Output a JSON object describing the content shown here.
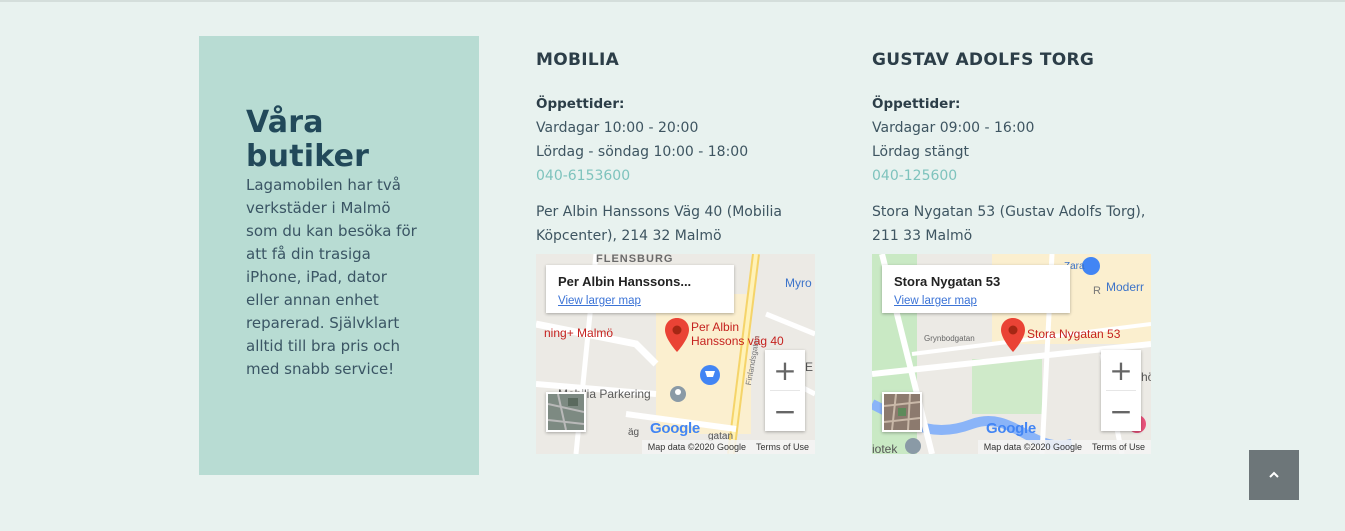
{
  "intro": {
    "title_line1": "Våra",
    "title_line2": "butiker",
    "text_lines": [
      "Lagamobilen har två",
      "verkstäder i Malmö",
      "som du kan besöka för",
      "att få din trasiga",
      "iPhone, iPad, dator",
      "eller annan enhet",
      "reparerad. Självklart",
      "alltid till bra pris och",
      "med snabb service!"
    ]
  },
  "stores": [
    {
      "name": "MOBILIA",
      "hours_label": "Öppettider:",
      "hours": [
        "Vardagar 10:00 - 20:00",
        "Lördag - söndag 10:00 - 18:00"
      ],
      "phone": "040-6153600",
      "address_lines": [
        "Per Albin Hanssons Väg 40 (Mobilia",
        "Köpcenter), 214 32 Malmö"
      ],
      "map": {
        "card_title": "Per Albin Hanssons...",
        "card_link": "View larger map",
        "pin_label_1": "Per Albin",
        "pin_label_2": "Hanssons väg 40",
        "labels": {
          "top": "FLENSBURG",
          "left": "ning+ Malmö",
          "parking": "Mobilia Parkering",
          "street": "Finlandsgatan",
          "edge1": "Myro",
          "edge2": "E",
          "bottom1": "äg",
          "bottom2": "gatan"
        },
        "attribution": "Map data ©2020 Google",
        "terms": "Terms of Use"
      }
    },
    {
      "name": "GUSTAV ADOLFS TORG",
      "hours_label": "Öppettider:",
      "hours": [
        "Vardagar 09:00 - 16:00",
        "Lördag stängt"
      ],
      "phone": "040-125600",
      "address_lines": [
        "Stora Nygatan 53 (Gustav Adolfs Torg),",
        "211 33 Malmö"
      ],
      "map": {
        "card_title": "Stora Nygatan 53",
        "card_link": "View larger map",
        "pin_label_1": "Stora Nygatan 53",
        "labels": {
          "street": "Grynbodgatan",
          "modern": "Moderr",
          "zara": "Zara",
          "edge": "hö",
          "bottom": "iotek",
          "r": "R"
        },
        "attribution": "Map data ©2020 Google",
        "terms": "Terms of Use"
      }
    }
  ],
  "map_controls": {
    "zoom_in": "+",
    "zoom_out": "−",
    "google": "Google"
  },
  "colors": {
    "page_bg": "#e8f2ef",
    "intro_bg": "#b8dcd3",
    "accent": "#7ec3bd",
    "totop_bg": "#6d7679"
  },
  "icons": {
    "totop": "chevron-up-icon",
    "pin": "map-pin-icon"
  }
}
